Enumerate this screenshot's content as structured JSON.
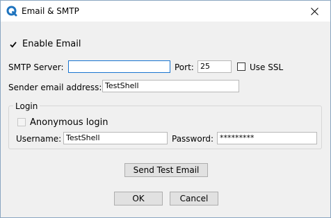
{
  "window": {
    "title": "Email & SMTP"
  },
  "enable_email": {
    "label": "Enable Email",
    "checked": true
  },
  "smtp": {
    "server_label": "SMTP Server:",
    "server_value": "",
    "port_label": "Port:",
    "port_value": "25",
    "ssl_label": "Use SSL",
    "ssl_checked": false
  },
  "sender": {
    "label": "Sender email address:",
    "value": "TestShell"
  },
  "login": {
    "group_label": "Login",
    "anonymous_label": "Anonymous login",
    "anonymous_checked": false,
    "username_label": "Username:",
    "username_value": "TestShell",
    "password_label": "Password:",
    "password_value": "*********"
  },
  "buttons": {
    "send_test": "Send Test Email",
    "ok": "OK",
    "cancel": "Cancel"
  },
  "icons": {
    "app": "q-logo-icon",
    "close": "close-icon",
    "check": "checkmark-icon"
  },
  "colors": {
    "focus_border": "#1874d0",
    "accent": "#1e73be"
  }
}
